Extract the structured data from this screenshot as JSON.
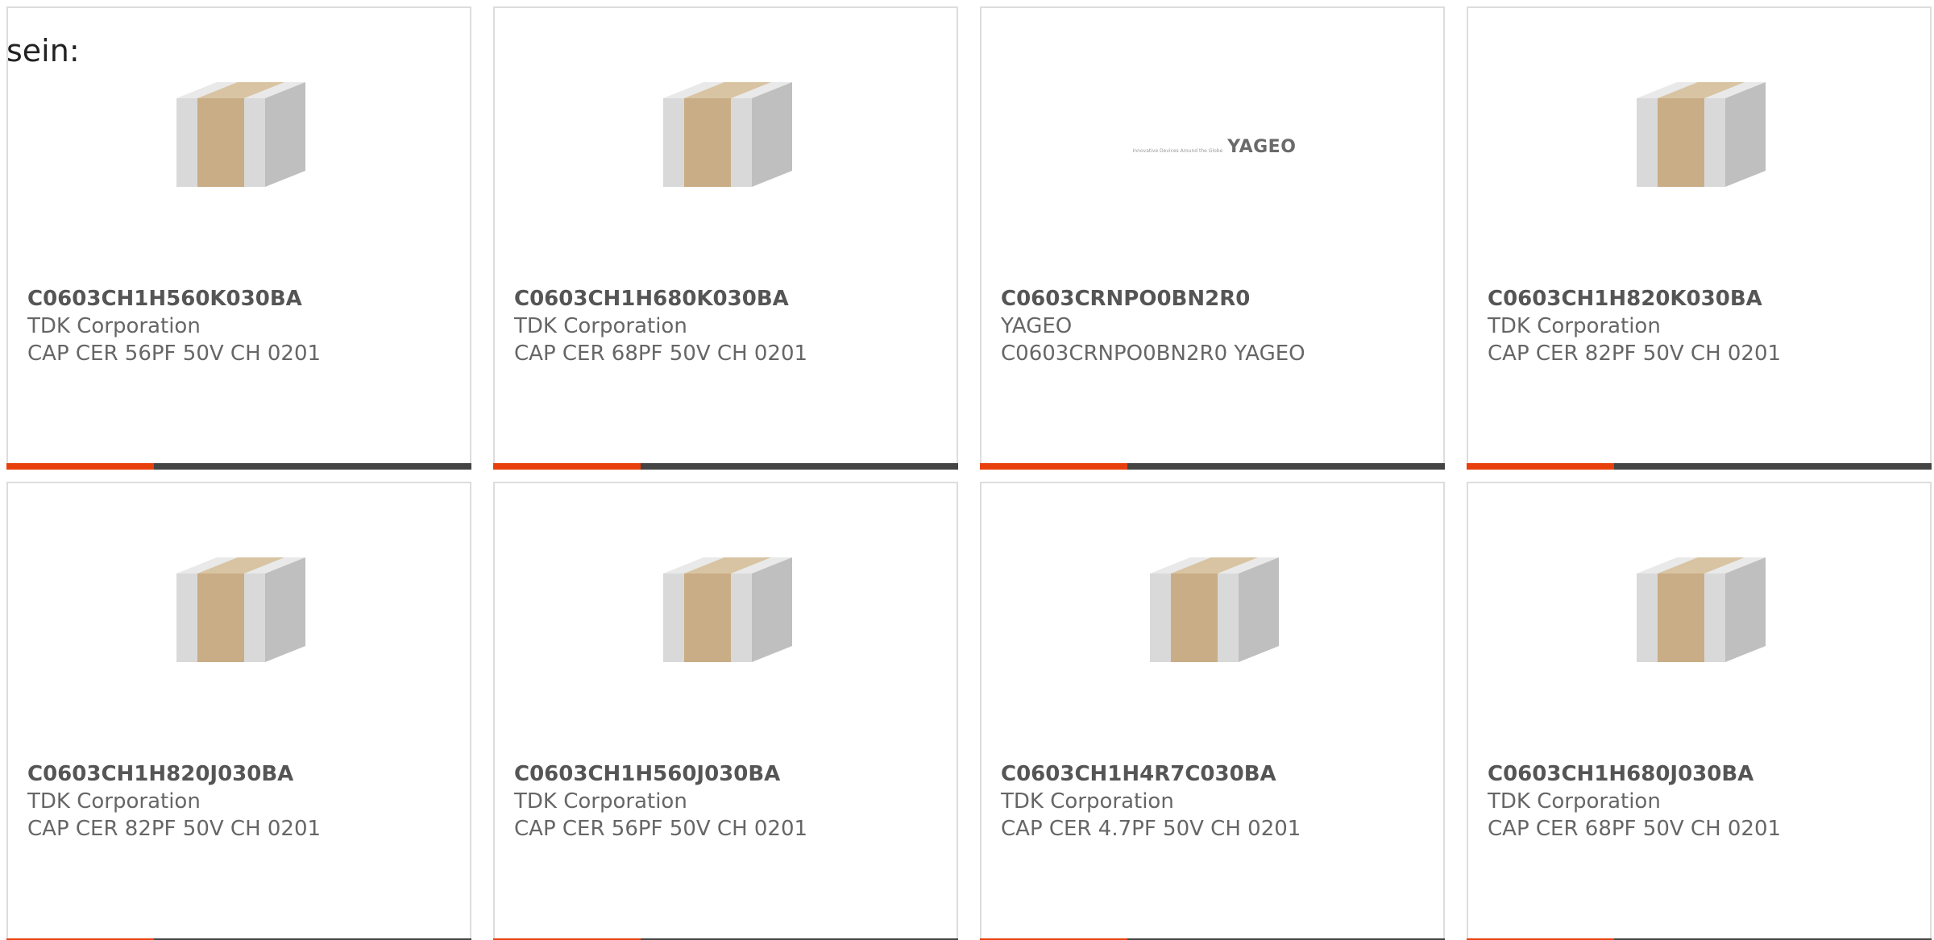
{
  "fragment_text": "sein:",
  "accent_color": "#e8400c",
  "bar_color": "#444444",
  "products": [
    {
      "part": "C0603CH1H560K030BA",
      "manufacturer": "TDK Corporation",
      "description": "CAP CER 56PF 50V CH 0201",
      "image": "capacitor-chip-icon"
    },
    {
      "part": "C0603CH1H680K030BA",
      "manufacturer": "TDK Corporation",
      "description": "CAP CER 68PF 50V CH 0201",
      "image": "capacitor-chip-icon"
    },
    {
      "part": "C0603CRNPO0BN2R0",
      "manufacturer": "YAGEO",
      "description": "C0603CRNPO0BN2R0 YAGEO",
      "image": "yageo-logo",
      "logo": {
        "tagline": "Innovative Devices Around the Globe",
        "brand": "YAGEO"
      }
    },
    {
      "part": "C0603CH1H820K030BA",
      "manufacturer": "TDK Corporation",
      "description": "CAP CER 82PF 50V CH 0201",
      "image": "capacitor-chip-icon"
    },
    {
      "part": "C0603CH1H820J030BA",
      "manufacturer": "TDK Corporation",
      "description": "CAP CER 82PF 50V CH 0201",
      "image": "capacitor-chip-icon"
    },
    {
      "part": "C0603CH1H560J030BA",
      "manufacturer": "TDK Corporation",
      "description": "CAP CER 56PF 50V CH 0201",
      "image": "capacitor-chip-icon"
    },
    {
      "part": "C0603CH1H4R7C030BA",
      "manufacturer": "TDK Corporation",
      "description": "CAP CER 4.7PF 50V CH 0201",
      "image": "capacitor-chip-icon"
    },
    {
      "part": "C0603CH1H680J030BA",
      "manufacturer": "TDK Corporation",
      "description": "CAP CER 68PF 50V CH 0201",
      "image": "capacitor-chip-icon"
    }
  ]
}
